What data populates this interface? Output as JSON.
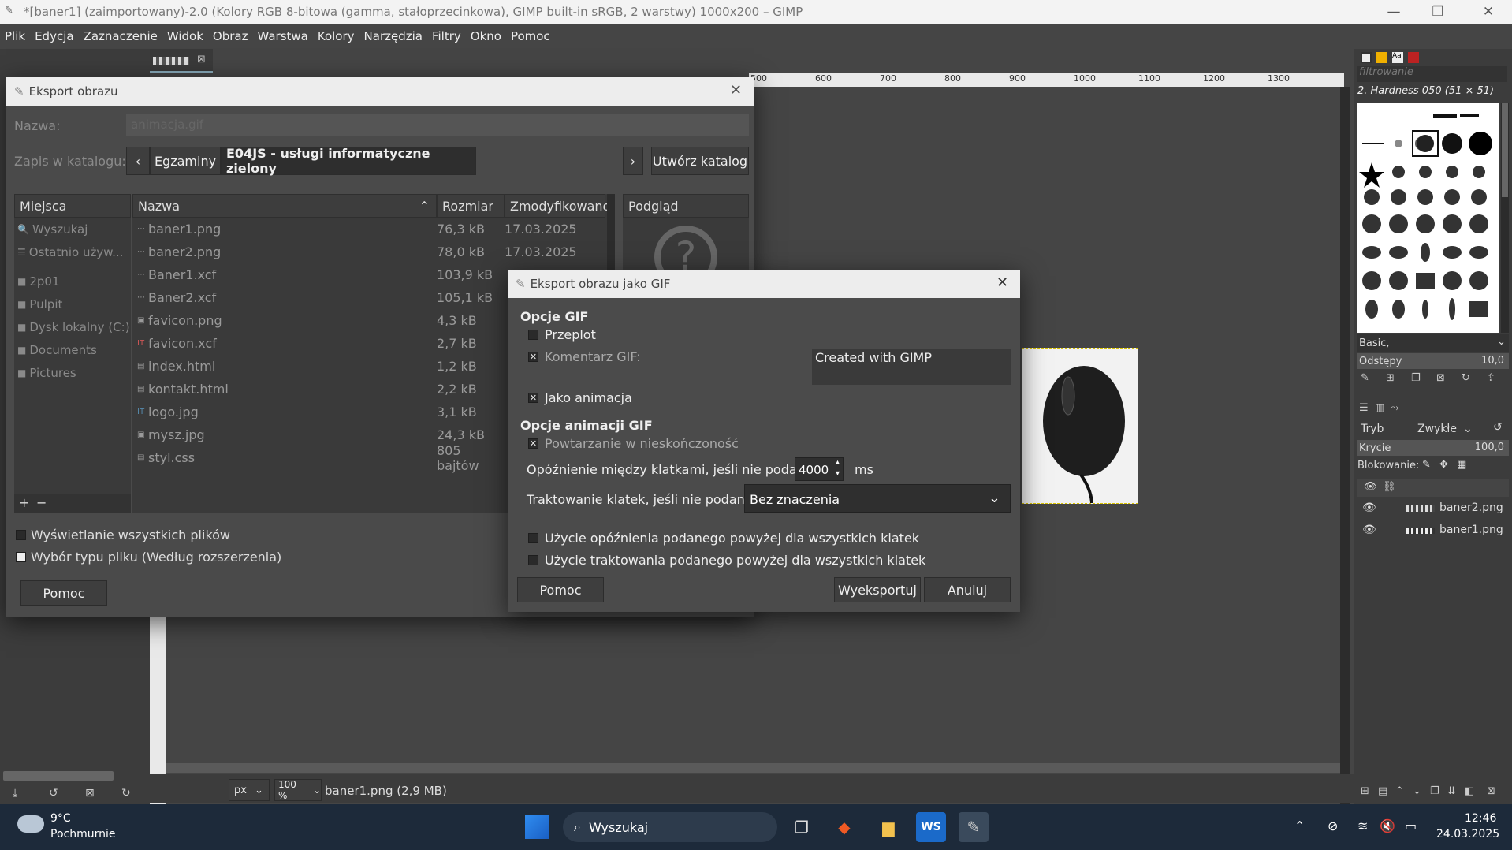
{
  "window": {
    "title": "*[baner1] (zaimportowany)-2.0 (Kolory RGB 8-bitowa (gamma, stałoprzecinkowa), GIMP built-in sRGB, 2 warstwy) 1000x200 – GIMP",
    "minimize": "—",
    "restore": "❐",
    "close": "✕"
  },
  "menu": [
    "Plik",
    "Edycja",
    "Zaznaczenie",
    "Widok",
    "Obraz",
    "Warstwa",
    "Kolory",
    "Narzędzia",
    "Filtry",
    "Okno",
    "Pomoc"
  ],
  "ruler": {
    "ticks": [
      "500",
      "600",
      "700",
      "800",
      "900",
      "1000",
      "1100",
      "1200",
      "1300"
    ]
  },
  "export_dialog": {
    "title": "Eksport obrazu",
    "name_label": "Nazwa:",
    "name_value": "animacja.gif",
    "save_in_label": "Zapis w katalogu:",
    "path": [
      "Egzaminy",
      "E04JS - usługi informatyczne zielony"
    ],
    "create_folder": "Utwórz katalog",
    "places_header": "Miejsca",
    "places": [
      "Wyszukaj",
      "Ostatnio używ...",
      "2p01",
      "Pulpit",
      "Dysk lokalny (C:)",
      "Documents",
      "Pictures"
    ],
    "columns": {
      "name": "Nazwa",
      "size": "Rozmiar",
      "modified": "Zmodyfikowano"
    },
    "preview_header": "Podgląd",
    "files": [
      {
        "name": "baner1.png",
        "size": "76,3 kB",
        "modified": "17.03.2025"
      },
      {
        "name": "baner2.png",
        "size": "78,0 kB",
        "modified": "17.03.2025"
      },
      {
        "name": "Baner1.xcf",
        "size": "103,9 kB",
        "modified": ""
      },
      {
        "name": "Baner2.xcf",
        "size": "105,1 kB",
        "modified": ""
      },
      {
        "name": "favicon.png",
        "size": "4,3 kB",
        "modified": ""
      },
      {
        "name": "favicon.xcf",
        "size": "2,7 kB",
        "modified": ""
      },
      {
        "name": "index.html",
        "size": "1,2 kB",
        "modified": ""
      },
      {
        "name": "kontakt.html",
        "size": "2,2 kB",
        "modified": ""
      },
      {
        "name": "logo.jpg",
        "size": "3,1 kB",
        "modified": ""
      },
      {
        "name": "mysz.jpg",
        "size": "24,3 kB",
        "modified": ""
      },
      {
        "name": "styl.css",
        "size": "805 bajtów",
        "modified": ""
      }
    ],
    "add": "+",
    "remove": "−",
    "show_all": "Wyświetlanie wszystkich plików",
    "file_type": "Wybór typu pliku (Według rozszerzenia)",
    "help": "Pomoc"
  },
  "gif_dialog": {
    "title": "Eksport obrazu jako GIF",
    "gif_options": "Opcje GIF",
    "interlace": "Przeplot",
    "comment_label": "Komentarz GIF:",
    "comment_value": "Created with GIMP",
    "as_animation": "Jako animacja",
    "anim_options": "Opcje animacji GIF",
    "loop": "Powtarzanie w nieskończoność",
    "delay_label": "Opóźnienie między klatkami, jeśli nie podano:",
    "delay_value": "4000",
    "delay_unit": "ms",
    "disposal_label": "Traktowanie klatek, jeśli nie podano:",
    "disposal_value": "Bez znaczenia",
    "use_delay_all": "Użycie opóźnienia podanego powyżej dla wszystkich klatek",
    "use_disposal_all": "Użycie traktowania podanego powyżej dla wszystkich klatek",
    "help": "Pomoc",
    "export": "Wyeksportuj",
    "cancel": "Anuluj"
  },
  "brushes": {
    "filter_placeholder": "filtrowanie",
    "brush_name": "2. Hardness 050 (51 × 51)",
    "preset": "Basic,",
    "spacing_label": "Odstępy",
    "spacing_value": "10,0"
  },
  "layers": {
    "mode_label": "Tryb",
    "mode_value": "Zwykłe",
    "opacity_label": "Krycie",
    "opacity_value": "100,0",
    "lock_label": "Blokowanie:",
    "items": [
      "baner2.png",
      "baner1.png"
    ]
  },
  "statusbar": {
    "unit": "px",
    "zoom": "100 %",
    "info": "baner1.png (2,9 MB)"
  },
  "taskbar": {
    "temp": "9°C",
    "weather": "Pochmurnie",
    "search": "Wyszukaj",
    "time": "12:46",
    "date": "24.03.2025"
  }
}
